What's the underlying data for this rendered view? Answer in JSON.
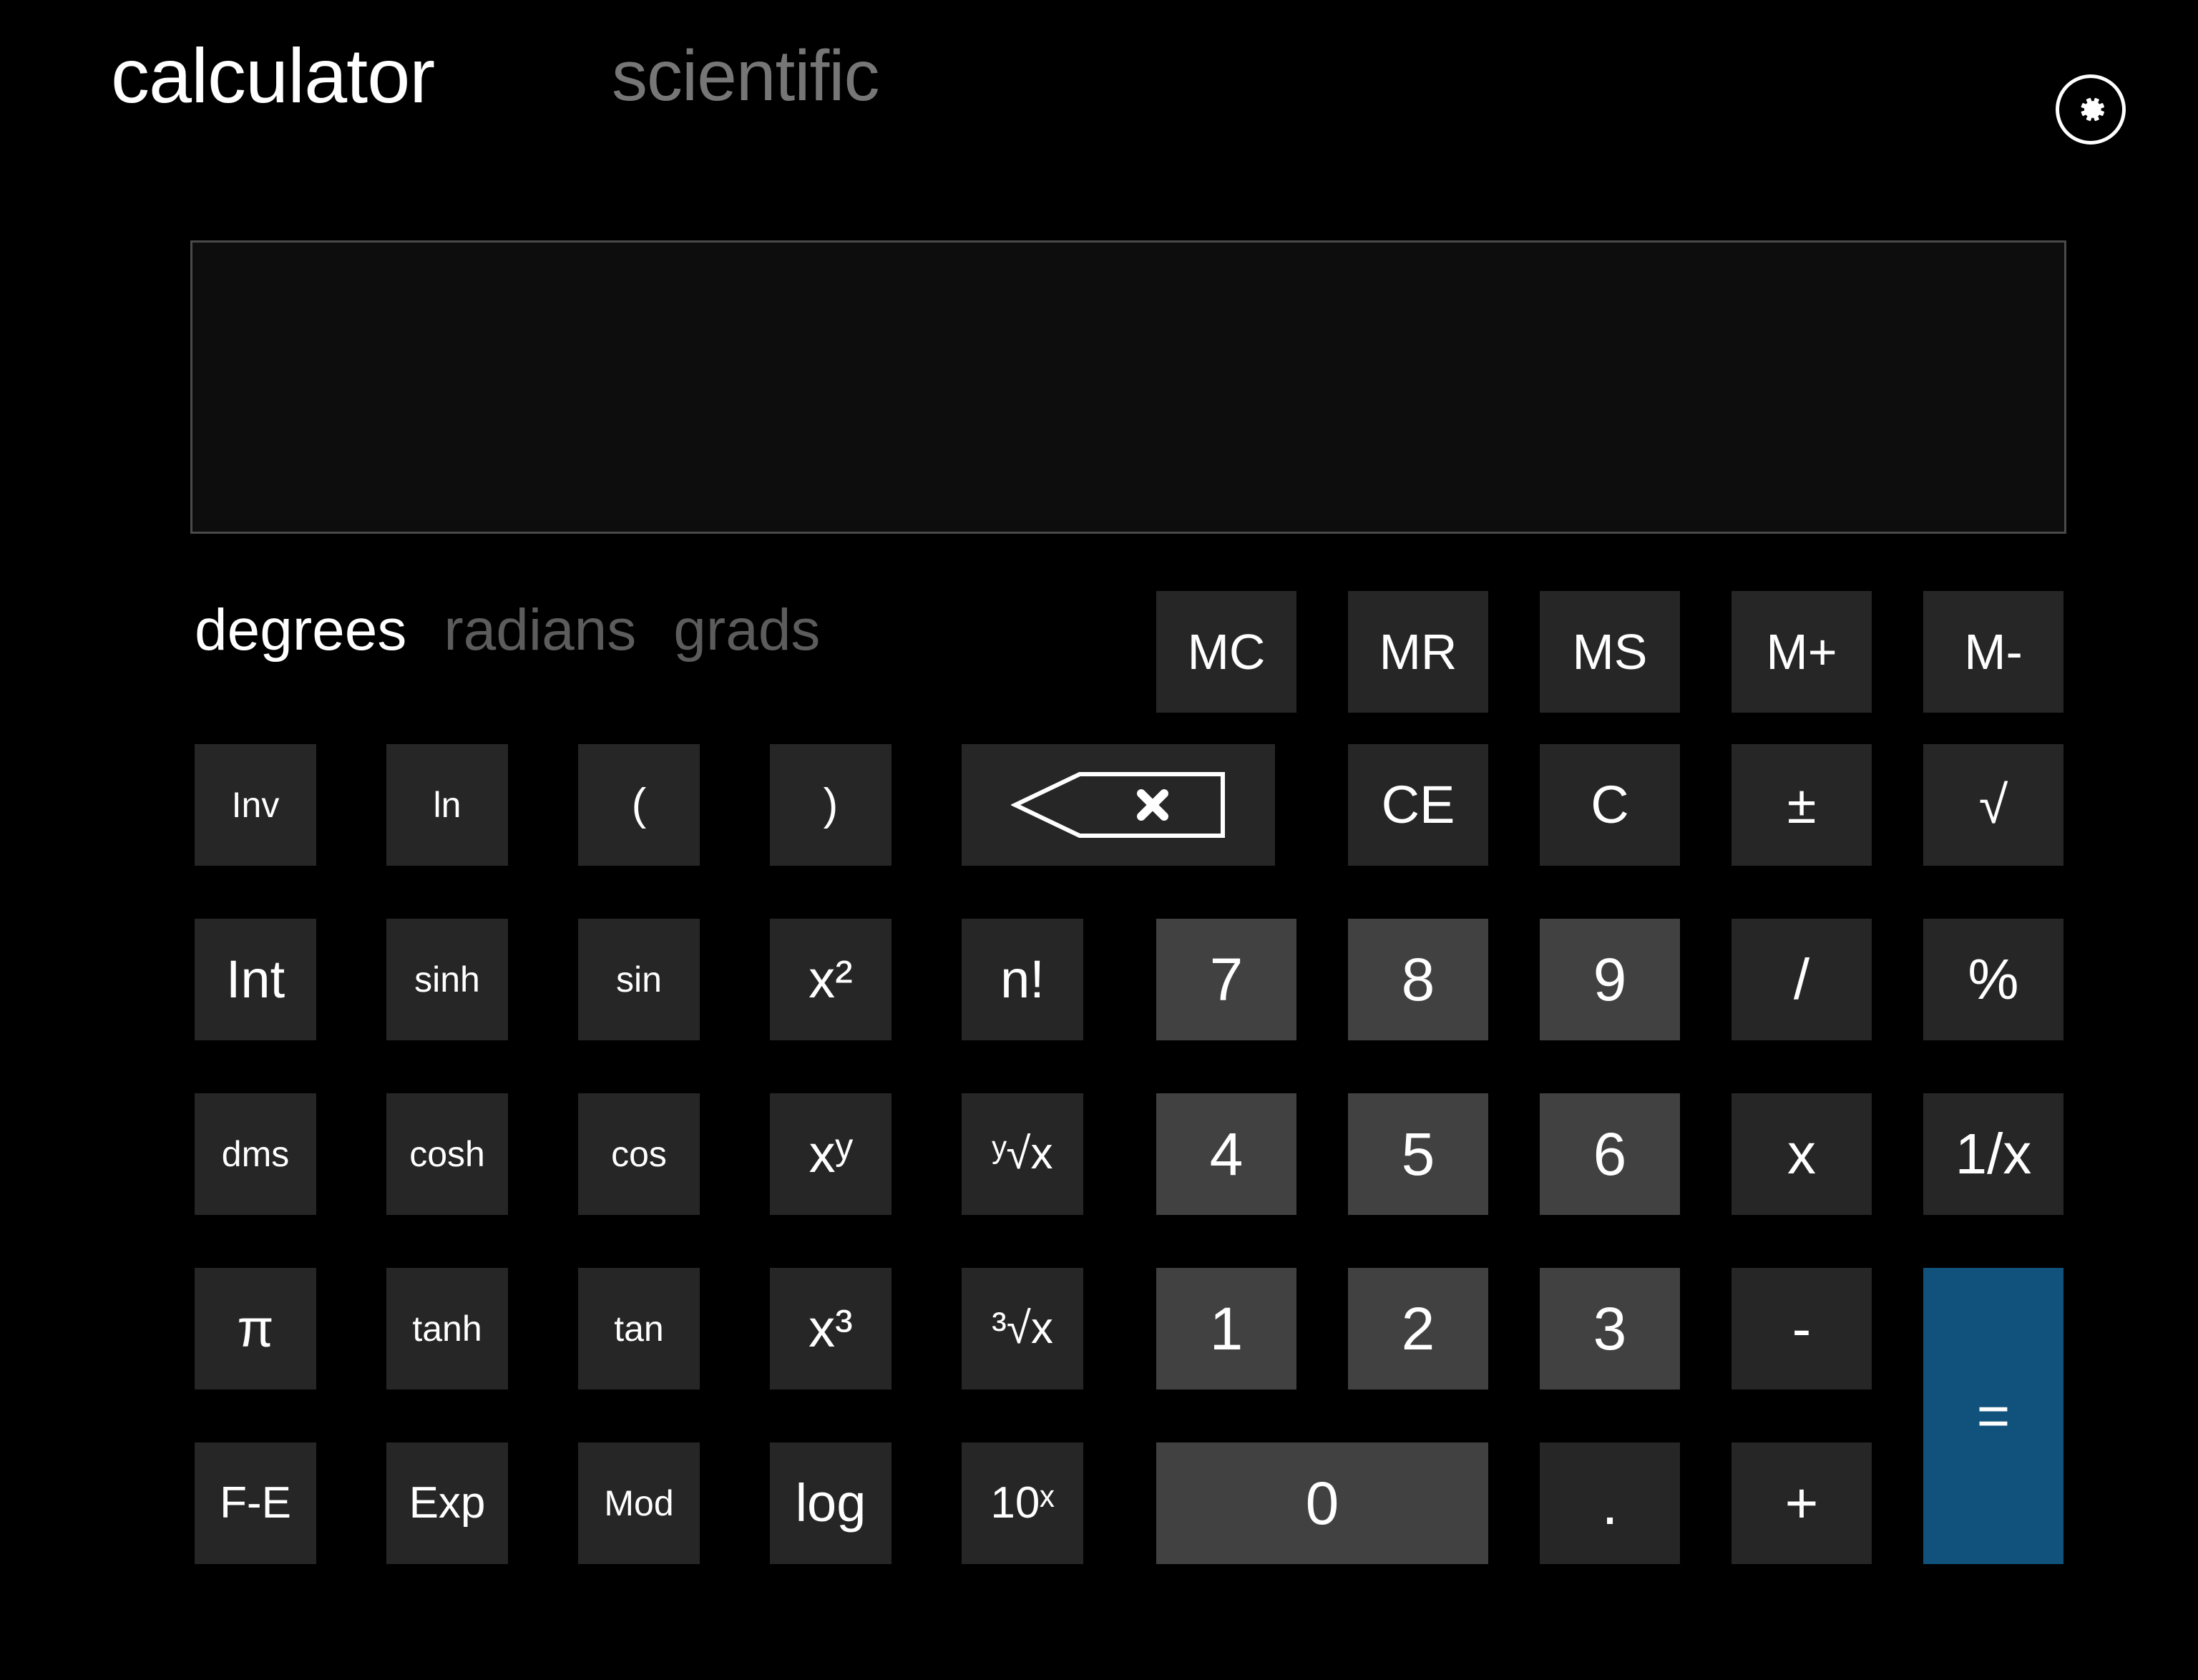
{
  "header": {
    "app_title": "calculator",
    "mode_label": "scientific",
    "settings_icon": "gear-icon"
  },
  "display": {
    "value": "",
    "placeholder": ""
  },
  "angle_modes": [
    {
      "label": "degrees",
      "active": true
    },
    {
      "label": "radians",
      "active": false
    },
    {
      "label": "grads",
      "active": false
    }
  ],
  "memory_buttons": [
    {
      "label": "MC"
    },
    {
      "label": "MR"
    },
    {
      "label": "MS"
    },
    {
      "label": "M+"
    },
    {
      "label": "M-"
    }
  ],
  "function_buttons": {
    "inv": "Inv",
    "ln": "ln",
    "paren_open": "(",
    "paren_close": ")",
    "backspace_icon": "backspace-icon",
    "int": "Int",
    "sinh": "sinh",
    "sin": "sin",
    "x_squared": "x²",
    "factorial": "n!",
    "dms": "dms",
    "cosh": "cosh",
    "cos": "cos",
    "x_pow_y": "xʸ",
    "y_root_x": "ʸ√x",
    "pi": "π",
    "tanh": "tanh",
    "tan": "tan",
    "x_cubed": "x³",
    "cube_root_x": "³√x",
    "fe": "F-E",
    "exp": "Exp",
    "mod": "Mod",
    "log": "log",
    "ten_pow_x": "10ˣ"
  },
  "edit_buttons": {
    "clear_entry": "CE",
    "clear": "C",
    "plus_minus": "±",
    "sqrt": "√"
  },
  "digits": {
    "d0": "0",
    "d1": "1",
    "d2": "2",
    "d3": "3",
    "d4": "4",
    "d5": "5",
    "d6": "6",
    "d7": "7",
    "d8": "8",
    "d9": "9",
    "decimal": "."
  },
  "operators": {
    "divide": "/",
    "percent": "%",
    "multiply": "x",
    "reciprocal": "1/x",
    "minus": "-",
    "plus": "+",
    "equals": "="
  },
  "colors": {
    "background": "#000000",
    "button_function": "#262626",
    "button_number": "#414141",
    "accent_equals": "#10527c",
    "text_primary": "#ffffff",
    "text_inactive": "#5c5c5c",
    "display_border": "#4a4a4a"
  }
}
